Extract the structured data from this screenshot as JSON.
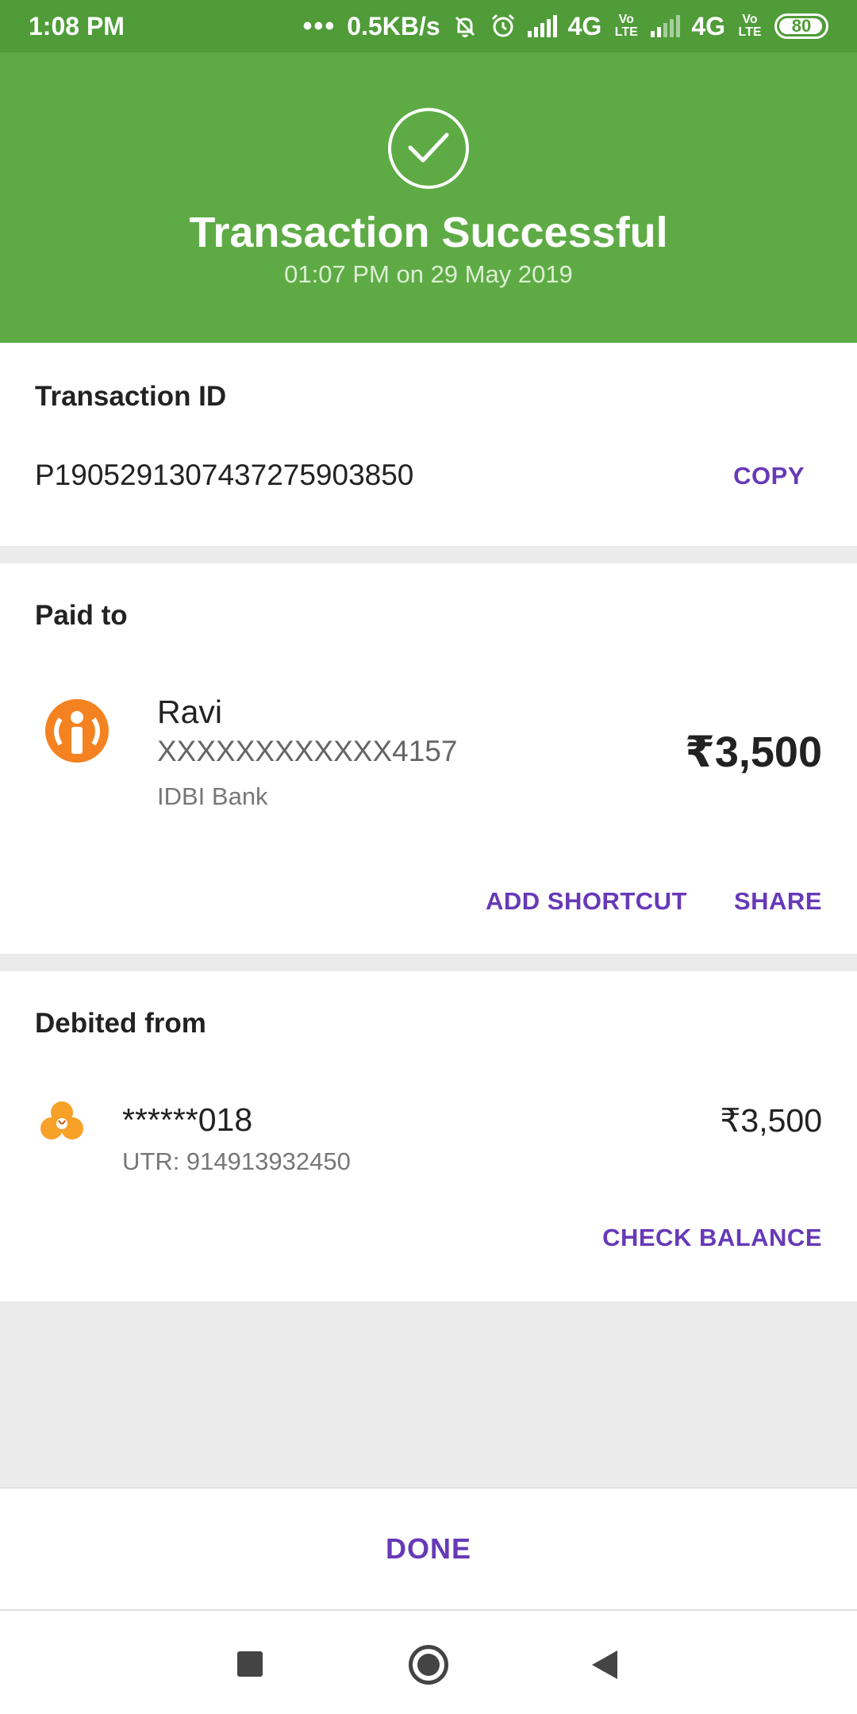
{
  "status_bar": {
    "time": "1:08 PM",
    "dots": "•••",
    "speed": "0.5KB/s",
    "network1": "4G",
    "network2": "4G",
    "volte": "Vo LTE",
    "battery": "80",
    "icons": [
      "mute-notifications-icon",
      "alarm-icon",
      "signal-icon",
      "signal-icon"
    ]
  },
  "header": {
    "icon": "check-circle-icon",
    "title": "Transaction Successful",
    "datetime": "01:07 PM on 29 May 2019",
    "bg_color": "#5eab45"
  },
  "transaction": {
    "label": "Transaction ID",
    "id": "P1905291307437275903850",
    "copy_label": "COPY"
  },
  "paid_to": {
    "label": "Paid to",
    "name": "Ravi",
    "account": "XXXXXXXXXXXX4157",
    "bank": "IDBI Bank",
    "amount": "₹3,500",
    "logo": "idbi-bank-logo",
    "actions": {
      "add_shortcut": "ADD SHORTCUT",
      "share": "SHARE"
    }
  },
  "debited_from": {
    "label": "Debited from",
    "account": "******018",
    "utr": "UTR: 914913932450",
    "amount": "₹3,500",
    "logo": "icici-bank-logo",
    "check_balance": "CHECK BALANCE"
  },
  "footer": {
    "done_label": "DONE"
  },
  "colors": {
    "accent": "#6739b7",
    "status_bar": "#4f9c38"
  }
}
